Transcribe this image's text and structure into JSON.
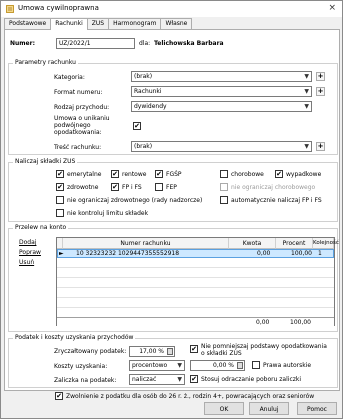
{
  "window": {
    "title": "Umowa cywilnoprawna",
    "close": "×"
  },
  "tabs": [
    {
      "label": "Podstawowe"
    },
    {
      "label": "Rachunki"
    },
    {
      "label": "ZUS"
    },
    {
      "label": "Harmonogram"
    },
    {
      "label": "Własne"
    }
  ],
  "header": {
    "numer_label": "Numer:",
    "numer_value": "UZ/2022/1",
    "dla_label": "dla:",
    "dla_value": "Telichowska Barbara"
  },
  "parametry": {
    "legend": "Parametry rachunku",
    "kategoria_label": "Kategoria:",
    "kategoria_value": "(brak)",
    "format_label": "Format numeru:",
    "format_value": "Rachunki",
    "rodzaj_label": "Rodzaj przychodu:",
    "rodzaj_value": "dywidendy",
    "umowa_label_1": "Umowa o unikaniu",
    "umowa_label_2": "podwójnego",
    "umowa_label_3": "opodatkowania:",
    "umowa_checked": "✔",
    "tresc_label": "Treść rachunku:",
    "tresc_value": "(brak)",
    "plus": "+"
  },
  "zus": {
    "legend": "Naliczaj składki ZUS",
    "emerytalne": "emerytalne",
    "rentowe": "rentowe",
    "fgsp": "FGŚP",
    "chorobowe": "chorobowe",
    "wypadkowe": "wypadkowe",
    "zdrowotne": "zdrowotne",
    "fpifs": "FP i FS",
    "fep": "FEP",
    "nie_ogr_chor": "nie ograniczaj chorobowego",
    "nie_ogr_zdrow": "nie ograniczaj zdrowotnego (rady nadzorcze)",
    "auto_fp": "automatycznie naliczaj FP i FS",
    "nie_kontroluj": "nie kontroluj limitu składek",
    "check": "✔"
  },
  "przelew": {
    "legend": "Przelew na konto",
    "dodaj": "Dodaj",
    "popraw": "Popraw",
    "usun": "Usuń",
    "columns": [
      "Numer rachunku",
      "Kwota",
      "Procent",
      "Kolejność"
    ],
    "rows": [
      {
        "marker": "►",
        "numer": "10 32323232 1029447355552918",
        "kwota": "0,00",
        "procent": "100,00",
        "kolejnosc": "1"
      }
    ],
    "totals": {
      "kwota": "0,00",
      "procent": "100,00"
    }
  },
  "podatek": {
    "legend": "Podatek i koszty uzyskania przychodów",
    "zrycz_label": "Zryczałtowany podatek:",
    "zrycz_value": "17,00 %",
    "niepomniejszaj_1": "Nie pomniejszaj podstawy opodatkowania",
    "niepomniejszaj_2": "o składki ZUS",
    "koszty_label": "Koszty uzyskania:",
    "koszty_value": "procentowo",
    "koszty_pct": "0,00 %",
    "prawa_autorskie": "Prawa autorskie",
    "zaliczka_label": "Zaliczka na podatek:",
    "zaliczka_value": "naliczać",
    "stosuj": "Stosuj odraczanie poboru zaliczki",
    "zwolnienie": "Zwolnienie z podatku dla osób do 26 r. ż., rodzin 4+, powracających oraz seniorów",
    "check": "✔"
  },
  "buttons": {
    "ok": "OK",
    "anuluj": "Anuluj",
    "pomoc": "Pomoc"
  }
}
